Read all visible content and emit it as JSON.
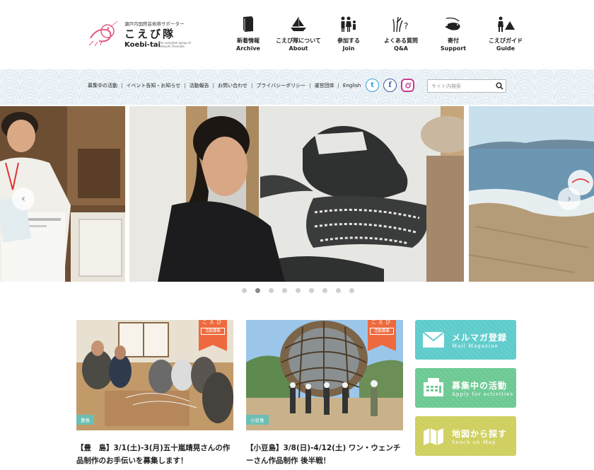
{
  "logo": {
    "kicker": "瀬戸内国際芸術祭サポーター",
    "kanji": "こえび隊",
    "romaji": "Koebi-tai",
    "tagline": "The volunteer group of Setouchi Triennale"
  },
  "gnav": [
    {
      "jp": "新着情報",
      "en": "Archive",
      "icon": "book-icon"
    },
    {
      "jp": "こえび隊について",
      "en": "About",
      "icon": "ship-icon"
    },
    {
      "jp": "参加する",
      "en": "Join",
      "icon": "people-icon"
    },
    {
      "jp": "よくある質問",
      "en": "Q&A",
      "icon": "question-icon"
    },
    {
      "jp": "寄付",
      "en": "Support",
      "icon": "shrimp-icon"
    },
    {
      "jp": "こえびガイド",
      "en": "Guide",
      "icon": "guide-icon"
    }
  ],
  "subnav": [
    "募集中の活動",
    "イベント告知・お知らせ",
    "活動報告",
    "お問い合わせ",
    "プライバシーポリシー",
    "運営団体",
    "English"
  ],
  "subnav_separator": "|",
  "social": {
    "twitter": "t",
    "facebook": "f",
    "instagram": "instagram-icon"
  },
  "search": {
    "placeholder": "サイト内検索"
  },
  "slider": {
    "prev": "‹",
    "next": "›",
    "dot_count": 9,
    "active_dot": 2
  },
  "cards": [
    {
      "ribbon_top": "こえび",
      "ribbon_bottom": "活動募集",
      "tag": "豊島",
      "title": "【豊　島】3/1(土)-3(月)五十嵐靖晃さんの作品制作のお手伝いを募集します！"
    },
    {
      "ribbon_top": "こえび",
      "ribbon_bottom": "活動募集",
      "tag": "小豆島",
      "title": "【小豆島】3/8(日)-4/12(土) ワン・ウェンチーさん作品制作 後半戦！"
    }
  ],
  "banners": [
    {
      "jp": "メルマガ登録",
      "en": "Mail Magazine",
      "icon": "mail-icon",
      "color": "#5ecbcb"
    },
    {
      "jp": "募集中の活動",
      "en": "Apply for activities",
      "icon": "fax-icon",
      "color": "#6cc993"
    },
    {
      "jp": "地図から探す",
      "en": "Seach on Map",
      "icon": "map-icon",
      "color": "#cfcf5e"
    }
  ],
  "colors": {
    "accent_orange": "#ee6a3e",
    "tag_teal": "#6cbfb5"
  }
}
